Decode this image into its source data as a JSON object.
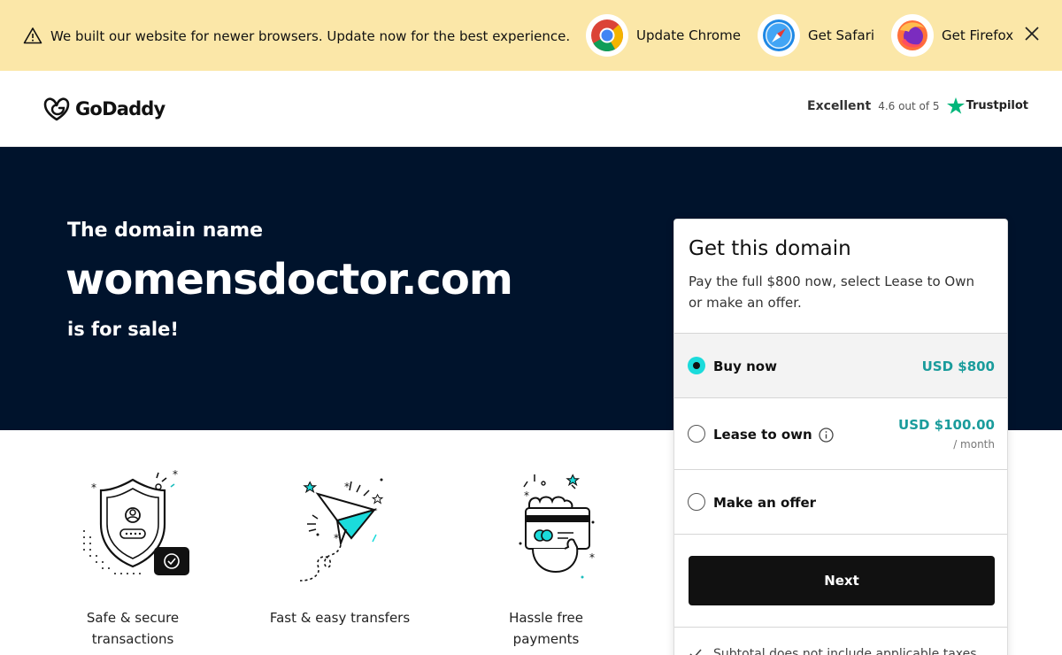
{
  "banner": {
    "message": "We built our website for newer browsers. Update now for the best experience.",
    "browsers": [
      {
        "label": "Update Chrome",
        "icon": "chrome-icon"
      },
      {
        "label": "Get Safari",
        "icon": "safari-icon"
      },
      {
        "label": "Get Firefox",
        "icon": "firefox-icon"
      }
    ],
    "bg_color": "#fbe7a8"
  },
  "header": {
    "logo_text": "GoDaddy",
    "rating_word": "Excellent",
    "rating_score": "4.6 out of 5",
    "trustpilot": "Trustpilot"
  },
  "hero": {
    "subtitle": "The domain name",
    "domain": "womensdoctor.com",
    "tagline": "is for sale!",
    "bg_color": "#00132c"
  },
  "features": [
    {
      "label": "Safe & secure transactions",
      "icon": "shield-user-icon"
    },
    {
      "label": "Fast & easy transfers",
      "icon": "paper-plane-icon"
    },
    {
      "label": "Hassle free payments",
      "icon": "hand-card-icon"
    }
  ],
  "card": {
    "title": "Get this domain",
    "description": "Pay the full $800 now, select Lease to Own or make an offer.",
    "options": [
      {
        "label": "Buy now",
        "price": "USD $800",
        "per": "",
        "selected": true
      },
      {
        "label": "Lease to own",
        "price": "USD $100.00",
        "per": "/ month",
        "selected": false
      },
      {
        "label": "Make an offer",
        "price": "",
        "per": "",
        "selected": false
      }
    ],
    "next_label": "Next",
    "footer_text": "Subtotal does not include applicable taxes",
    "accent_color": "#1bdbdb",
    "price_color": "#1a9c9c"
  }
}
